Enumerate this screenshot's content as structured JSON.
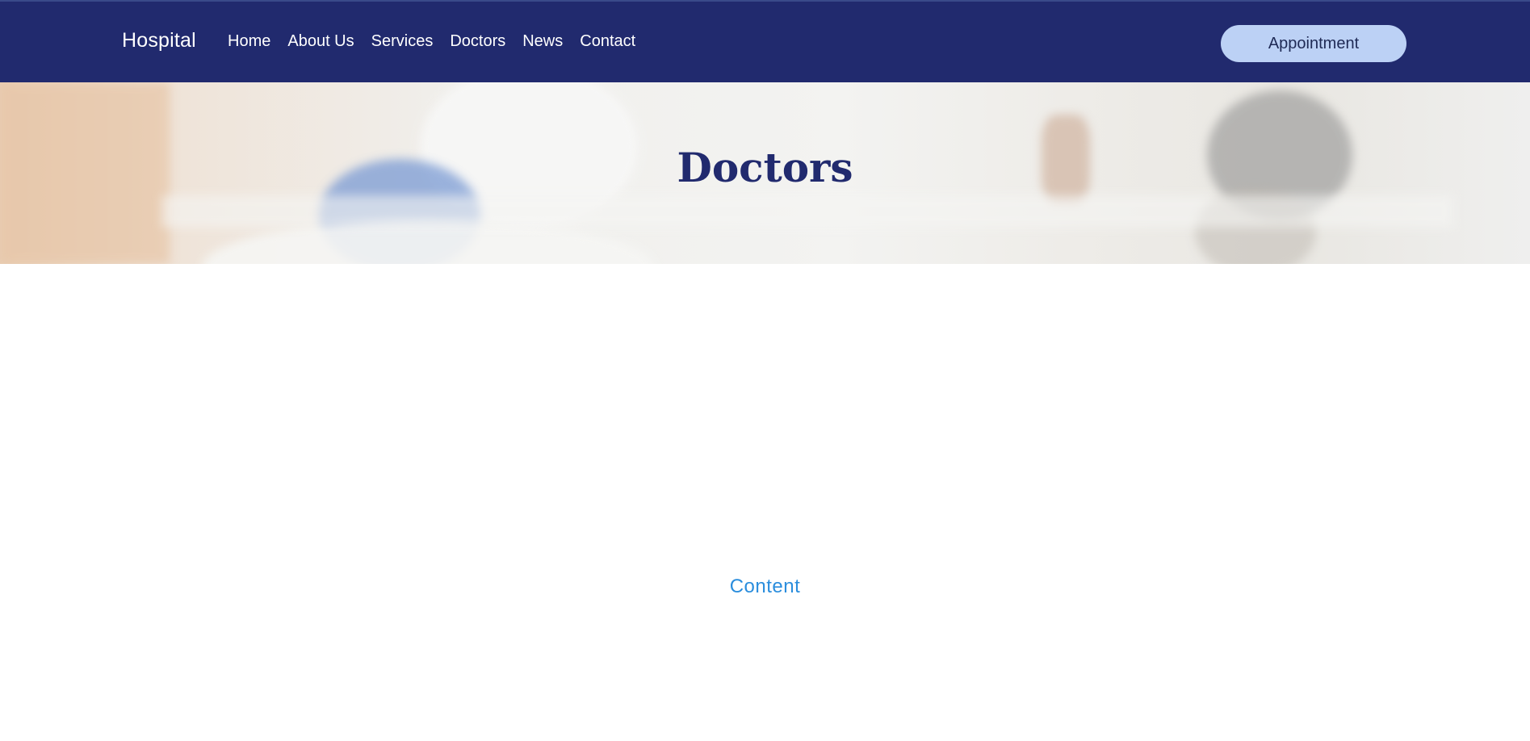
{
  "header": {
    "brand": "Hospital",
    "nav": [
      "Home",
      "About Us",
      "Services",
      "Doctors",
      "News",
      "Contact"
    ],
    "appointment_label": "Appointment"
  },
  "hero": {
    "title": "Doctors"
  },
  "main": {
    "content_label": "Content"
  },
  "colors": {
    "header_bg": "#212a6e",
    "button_bg": "#bcd1f5",
    "title": "#212a6e",
    "content_link": "#2a8ddd"
  }
}
